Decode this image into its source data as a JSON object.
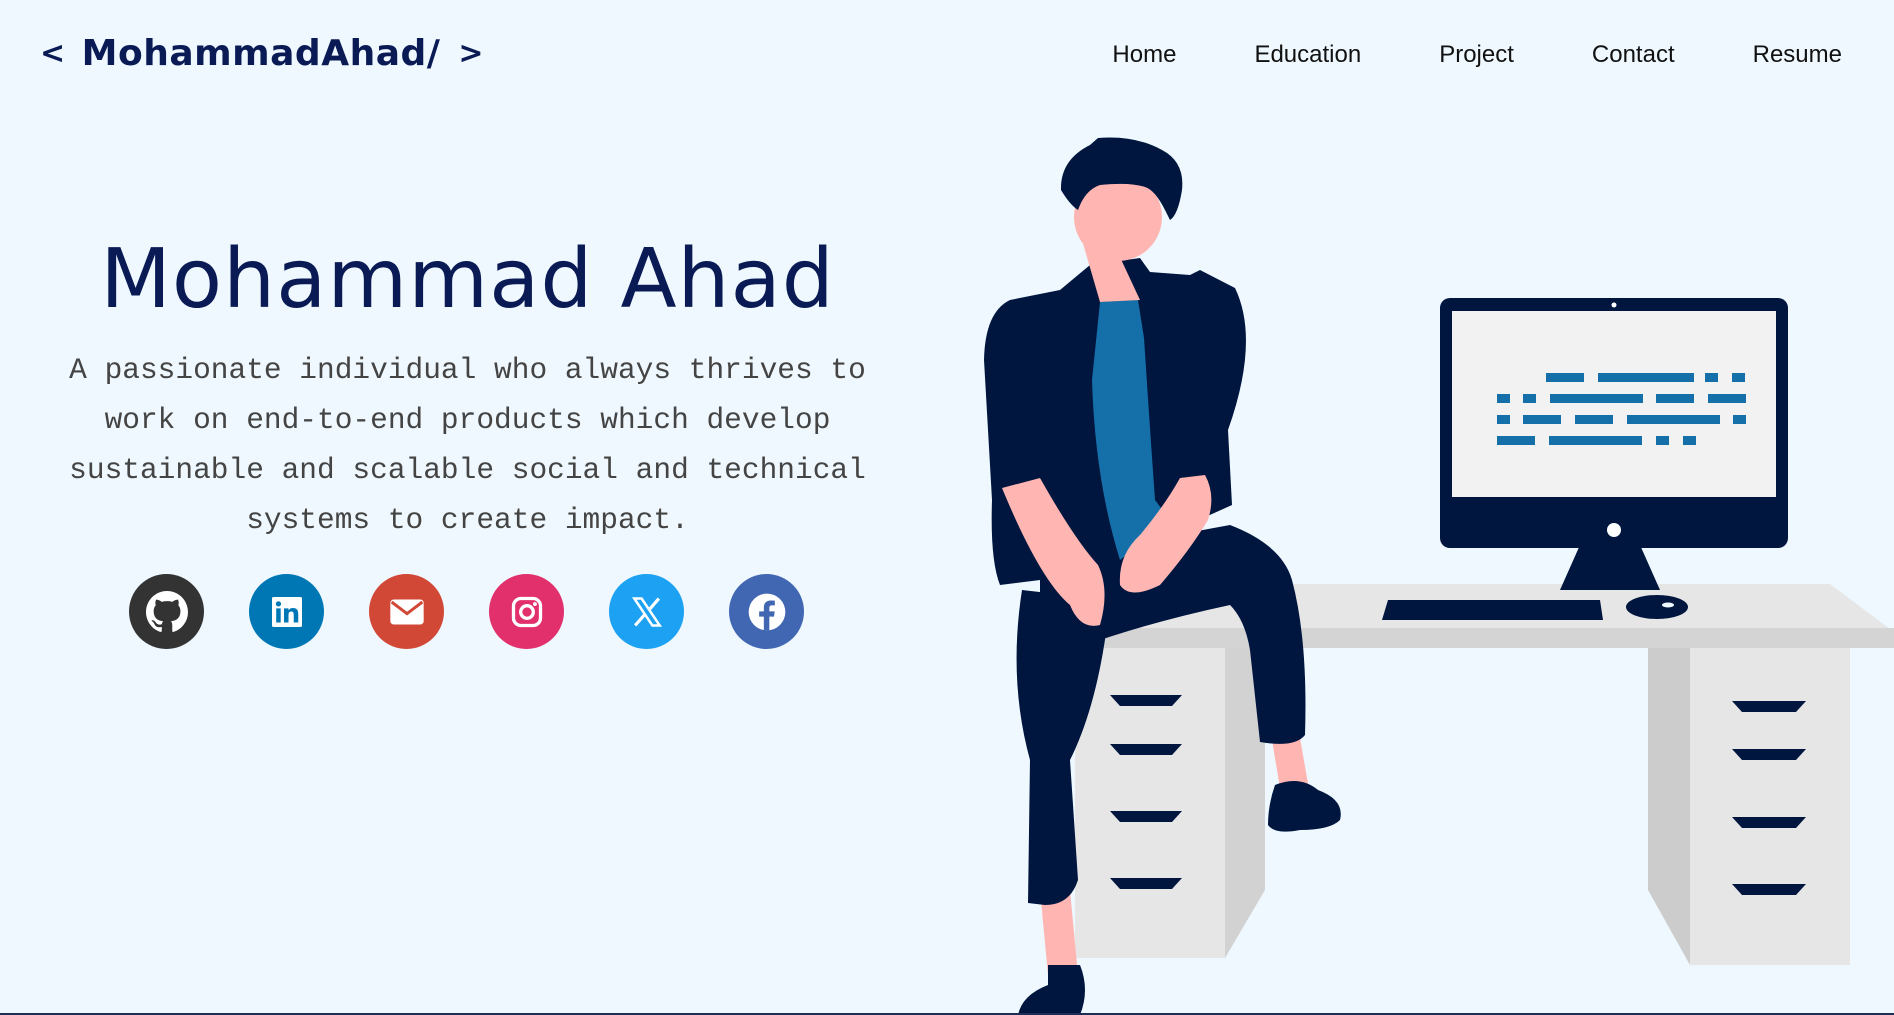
{
  "navbar": {
    "brand": {
      "left_chevron": "<",
      "name": "MohammadAhad/",
      "right_chevron": ">"
    },
    "links": [
      "Home",
      "Education",
      "Project",
      "Contact",
      "Resume"
    ]
  },
  "hero": {
    "title": "Mohammad Ahad",
    "description": "A passionate individual who always thrives to work on end-to-end products which develop sustainable and scalable social and technical systems to create impact."
  },
  "socials": [
    {
      "icon": "github-icon",
      "color": "#333333"
    },
    {
      "icon": "linkedin-icon",
      "color": "#0077b5"
    },
    {
      "icon": "email-icon",
      "color": "#d14836"
    },
    {
      "icon": "instagram-icon",
      "color": "#e1306c"
    },
    {
      "icon": "x-icon",
      "color": "#1da1f2"
    },
    {
      "icon": "facebook-icon",
      "color": "#4267b2"
    }
  ],
  "colors": {
    "background": "#eef8fe",
    "brand_navy": "#0a1a55",
    "illustration_navy": "#00163f",
    "illustration_blue": "#1570aa",
    "skin": "#ffb6b3",
    "desk_gray": "#e6e6e6"
  }
}
